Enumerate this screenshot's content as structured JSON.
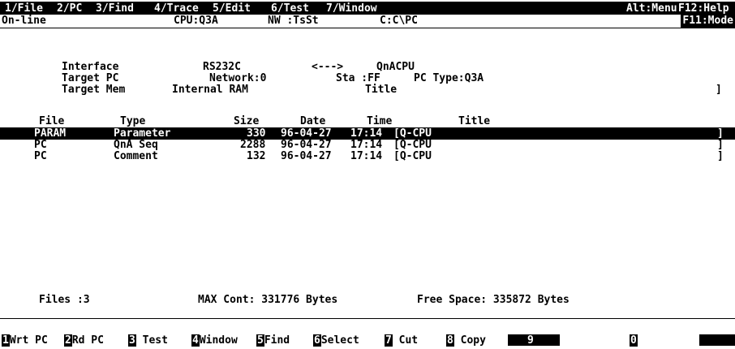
{
  "menu": {
    "items": [
      "1/File",
      "2/PC",
      "3/Find",
      "4/Trace",
      "5/Edit",
      "6/Test",
      "7/Window"
    ],
    "alt": "Alt:Menu",
    "f12": "F12:Help"
  },
  "status": {
    "mode": "On-line",
    "cpu": "CPU:Q3A",
    "nw": "NW :TsSt",
    "path": "C:C\\PC",
    "f11": "F11:Mode"
  },
  "connection": {
    "interface_label": "Interface",
    "interface_value": "RS232C",
    "arrow": "<--->",
    "target_cpu": "QnACPU",
    "target_pc_label": "Target PC",
    "network": "Network:0",
    "sta": "Sta :FF",
    "pc_type": "PC Type:Q3A",
    "target_mem_label": "Target Mem",
    "target_mem_value": "Internal RAM",
    "title_label": "Title",
    "title_close": "]"
  },
  "file_table": {
    "headers": [
      "File",
      "Type",
      "Size",
      "Date",
      "Time",
      "Title"
    ],
    "rows": [
      {
        "file": "PARAM",
        "type": "Parameter",
        "size": "330",
        "date": "96-04-27",
        "time": "17:14",
        "title": "[Q-CPU",
        "close": "]",
        "selected": true
      },
      {
        "file": "PC",
        "type": "QnA Seq",
        "size": "2288",
        "date": "96-04-27",
        "time": "17:14",
        "title": "[Q-CPU",
        "close": "]",
        "selected": false
      },
      {
        "file": "PC",
        "type": "Comment",
        "size": "132",
        "date": "96-04-27",
        "time": "17:14",
        "title": "[Q-CPU",
        "close": "]",
        "selected": false
      }
    ]
  },
  "summary": {
    "files": "Files :3",
    "max_cont": "MAX Cont: 331776 Bytes",
    "free_space": "Free Space: 335872 Bytes"
  },
  "function_keys": [
    {
      "num": "1",
      "label": "Wrt PC"
    },
    {
      "num": "2",
      "label": "Rd PC"
    },
    {
      "num": "3",
      "label": "Test"
    },
    {
      "num": "4",
      "label": "Window"
    },
    {
      "num": "5",
      "label": "Find"
    },
    {
      "num": "6",
      "label": "Select"
    },
    {
      "num": "7",
      "label": "Cut"
    },
    {
      "num": "8",
      "label": "Copy"
    },
    {
      "num": "9",
      "label": ""
    },
    {
      "num": "0",
      "label": ""
    }
  ]
}
